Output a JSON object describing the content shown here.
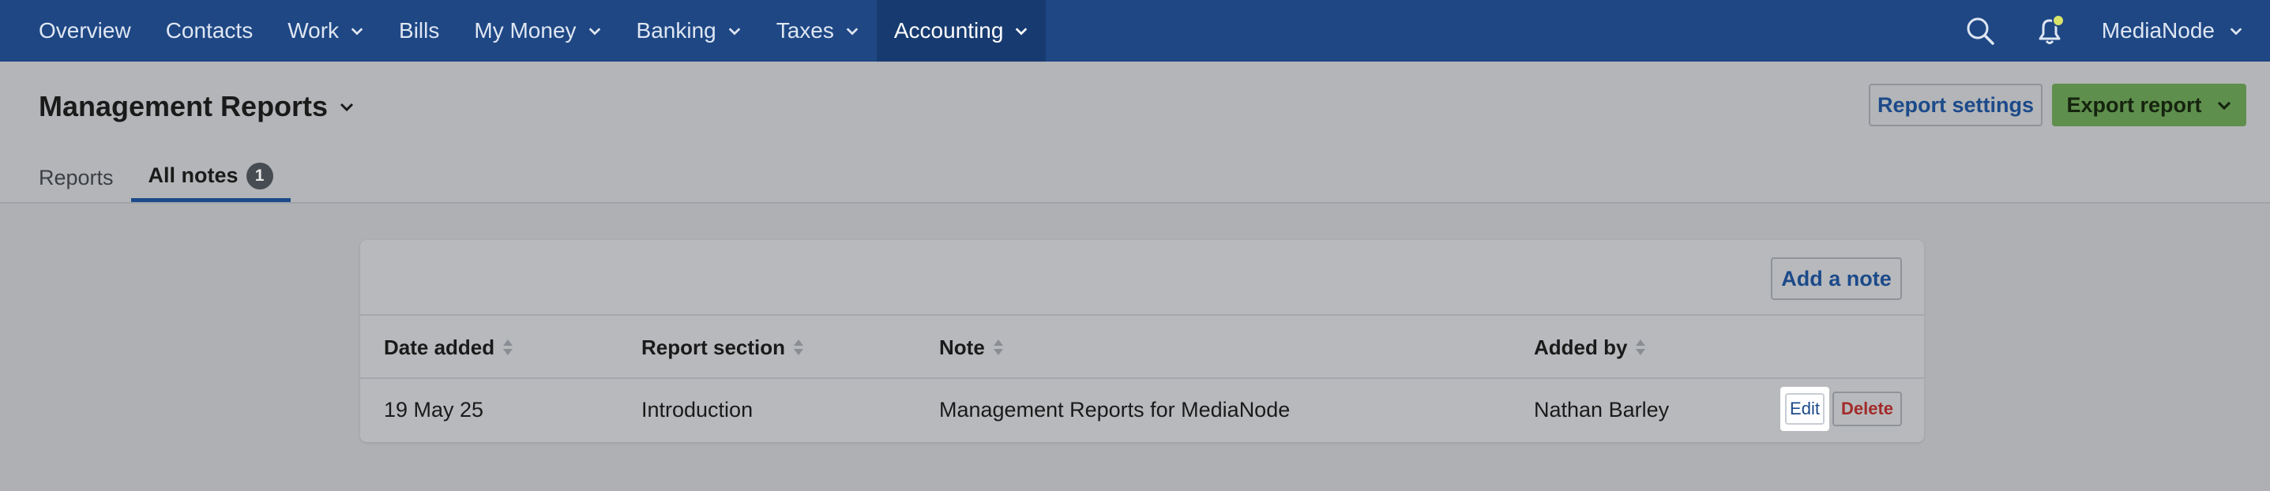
{
  "nav": {
    "items": [
      {
        "label": "Overview",
        "dropdown": false
      },
      {
        "label": "Contacts",
        "dropdown": false
      },
      {
        "label": "Work",
        "dropdown": true
      },
      {
        "label": "Bills",
        "dropdown": false
      },
      {
        "label": "My Money",
        "dropdown": true
      },
      {
        "label": "Banking",
        "dropdown": true
      },
      {
        "label": "Taxes",
        "dropdown": true
      },
      {
        "label": "Accounting",
        "dropdown": true,
        "active": true
      }
    ],
    "search_icon": "search-icon",
    "notification_icon": "bell-icon",
    "org_name": "MediaNode"
  },
  "header": {
    "title": "Management Reports",
    "report_settings_label": "Report settings",
    "export_label": "Export report",
    "tabs": [
      {
        "label": "Reports",
        "active": false
      },
      {
        "label": "All notes",
        "active": true,
        "badge": "1"
      }
    ]
  },
  "notes": {
    "add_label": "Add a note",
    "columns": [
      "Date added",
      "Report section",
      "Note",
      "Added by"
    ],
    "rows": [
      {
        "date": "19 May 25",
        "section": "Introduction",
        "note": "Management Reports for MediaNode",
        "added_by": "Nathan Barley",
        "edit_label": "Edit",
        "delete_label": "Delete"
      }
    ]
  },
  "colors": {
    "nav_bg": "#1e4784",
    "nav_active": "#173b70",
    "accent_link": "#1c4a8a",
    "export_green": "#5f8f4d",
    "delete_red": "#a32a2a",
    "notification_dot": "#d8e36a"
  }
}
